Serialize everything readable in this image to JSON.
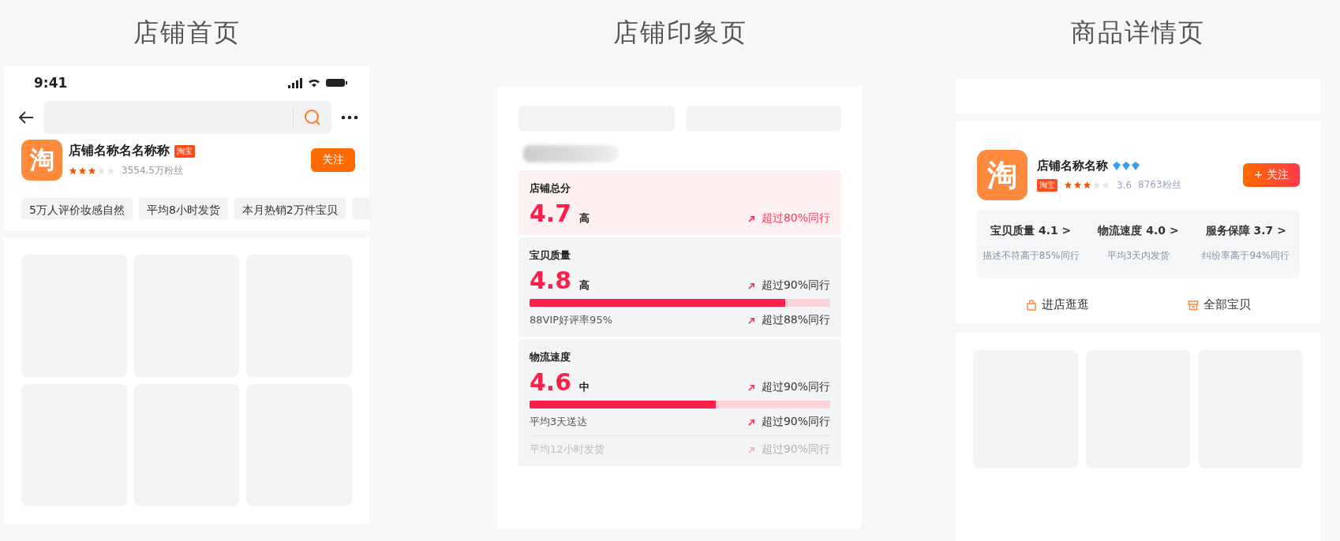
{
  "sections": [
    {
      "kind": "store_home",
      "title": "店铺首页",
      "status_time": "9:41",
      "shop": {
        "logo": "淘",
        "name": "店铺名称名名称称",
        "badge": "淘宝",
        "stars": 3,
        "fans": "3554.5万粉丝",
        "follow": "关注"
      },
      "tags": [
        "5万人评价妆感自然",
        "平均8小时发货",
        "本月热销2万件宝贝"
      ]
    },
    {
      "kind": "impression",
      "title": "店铺印象页",
      "scores": [
        {
          "kind": "total",
          "label": "店铺总分",
          "score": "4.7",
          "grade": "高",
          "compare": "超过80%同行"
        },
        {
          "kind": "bar",
          "label": "宝贝质量",
          "score": "4.8",
          "grade": "高",
          "compare": "超过90%同行",
          "level": 0.85,
          "details": [
            {
              "text": "88VIP好评率95%",
              "compare": "超过88%同行",
              "faded": false
            }
          ]
        },
        {
          "kind": "bar",
          "label": "物流速度",
          "score": "4.6",
          "grade": "中",
          "compare": "超过90%同行",
          "level": 0.62,
          "details": [
            {
              "text": "平均3天送达",
              "compare": "超过90%同行",
              "faded": false
            },
            {
              "text": "平均12小时发货",
              "compare": "超过90%同行",
              "faded": true
            }
          ]
        }
      ]
    },
    {
      "kind": "detail",
      "title": "商品详情页",
      "shop": {
        "logo": "淘",
        "name": "店铺名称名称",
        "badge": "淘宝",
        "stars": 3,
        "rating": "3.6",
        "fans": "8763粉丝",
        "follow": "+ 关注"
      },
      "metrics": [
        {
          "label": "宝贝质量 4.1 >",
          "note": "描述不符高于85%同行"
        },
        {
          "label": "物流速度 4.0 >",
          "note": "平均3天内发货"
        },
        {
          "label": "服务保障 3.7 >",
          "note": "纠纷率高于94%同行"
        }
      ],
      "actions": [
        {
          "kind": "shop",
          "label": "进店逛逛"
        },
        {
          "kind": "all",
          "label": "全部宝贝"
        }
      ]
    }
  ]
}
